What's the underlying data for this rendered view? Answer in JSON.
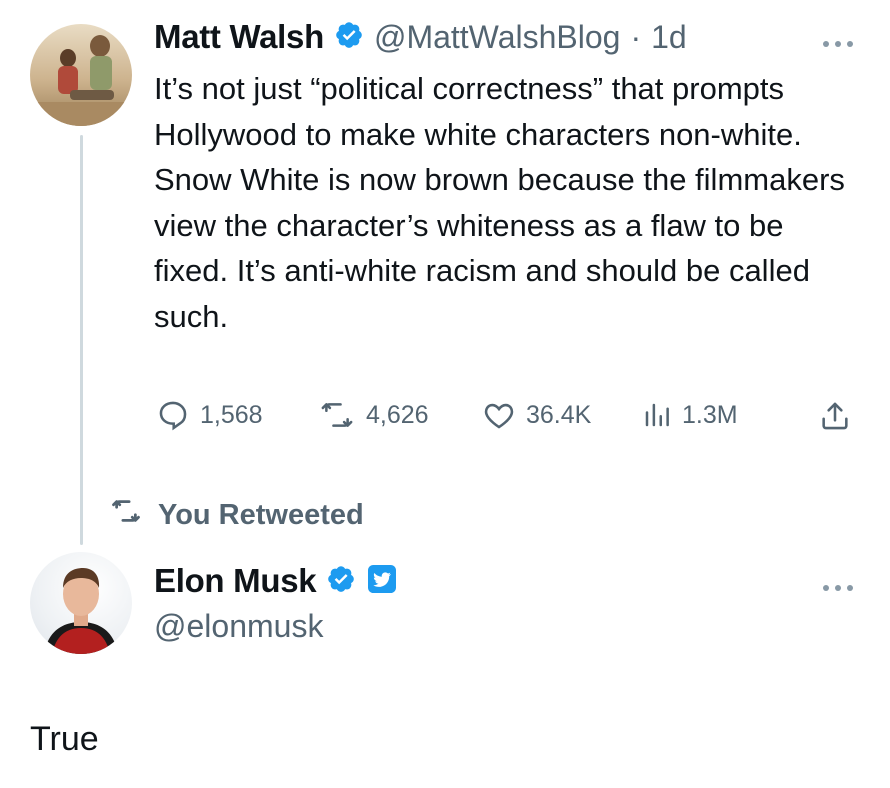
{
  "colors": {
    "text": "#0f1419",
    "muted": "#536471",
    "verified_blue": "#1d9bf0",
    "thread_line": "#cfd9de"
  },
  "quoted_tweet": {
    "author_name": "Matt Walsh",
    "author_handle": "@MattWalshBlog",
    "separator": "·",
    "time_ago": "1d",
    "text": "It’s not just “political correctness” that prompts Hollywood to make white characters non-white. Snow White is now brown because the filmmakers view the character’s whiteness as a flaw to be fixed. It’s anti-white racism and should be called such.",
    "stats": {
      "replies": "1,568",
      "retweets": "4,626",
      "likes": "36.4K",
      "views": "1.3M"
    },
    "icons": [
      "verified-badge-icon",
      "reply-icon",
      "retweet-icon",
      "like-icon",
      "views-icon",
      "share-icon",
      "more-icon"
    ]
  },
  "retweet_notice": {
    "label": "You Retweeted"
  },
  "reply_tweet": {
    "author_name": "Elon Musk",
    "author_handle": "@elonmusk",
    "text": "True",
    "icons": [
      "verified-badge-icon",
      "affiliate-twitter-badge-icon",
      "more-icon"
    ]
  }
}
